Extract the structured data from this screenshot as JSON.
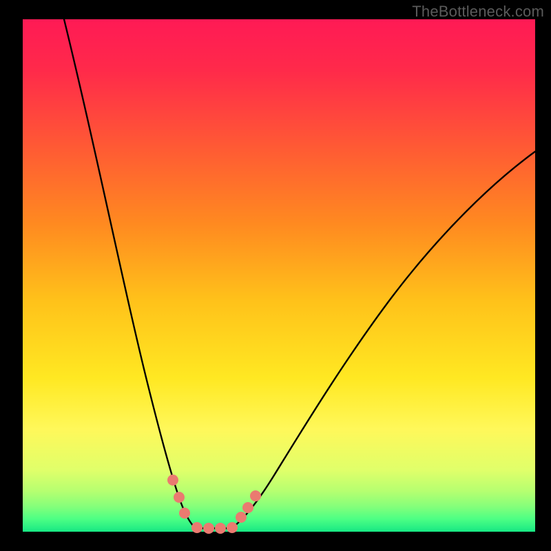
{
  "watermark": "TheBottleneck.com",
  "chart_data": {
    "type": "line",
    "title": "",
    "xlabel": "",
    "ylabel": "",
    "xlim": [
      0,
      100
    ],
    "ylim": [
      0,
      100
    ],
    "background_gradient": {
      "orientation": "vertical",
      "stops": [
        {
          "pos": 0.0,
          "color": "#ff1a55"
        },
        {
          "pos": 0.25,
          "color": "#ff5a34"
        },
        {
          "pos": 0.55,
          "color": "#ffc21a"
        },
        {
          "pos": 0.8,
          "color": "#fff85a"
        },
        {
          "pos": 0.95,
          "color": "#86ff7a"
        },
        {
          "pos": 1.0,
          "color": "#17e884"
        }
      ]
    },
    "series": [
      {
        "name": "bottleneck-curve",
        "color": "#000000",
        "x": [
          8,
          12,
          16,
          20,
          24,
          28,
          30,
          32,
          34,
          36,
          38,
          40,
          44,
          50,
          58,
          66,
          74,
          82,
          90,
          100
        ],
        "y": [
          100,
          78,
          58,
          42,
          28,
          16,
          10,
          5,
          1,
          0,
          0,
          0,
          4,
          12,
          26,
          40,
          53,
          62,
          69,
          74
        ]
      }
    ],
    "markers": {
      "color": "#ea7a70",
      "radius": 8,
      "points": [
        {
          "x": 29,
          "y": 10
        },
        {
          "x": 30,
          "y": 6
        },
        {
          "x": 31,
          "y": 3
        },
        {
          "x": 34,
          "y": 0
        },
        {
          "x": 36,
          "y": 0
        },
        {
          "x": 38,
          "y": 0
        },
        {
          "x": 40,
          "y": 0
        },
        {
          "x": 42,
          "y": 2
        },
        {
          "x": 43,
          "y": 4
        },
        {
          "x": 45,
          "y": 6
        }
      ]
    },
    "annotations": [
      {
        "text": "TheBottleneck.com",
        "pos": "top-right",
        "color": "#5b5b5b"
      }
    ]
  }
}
